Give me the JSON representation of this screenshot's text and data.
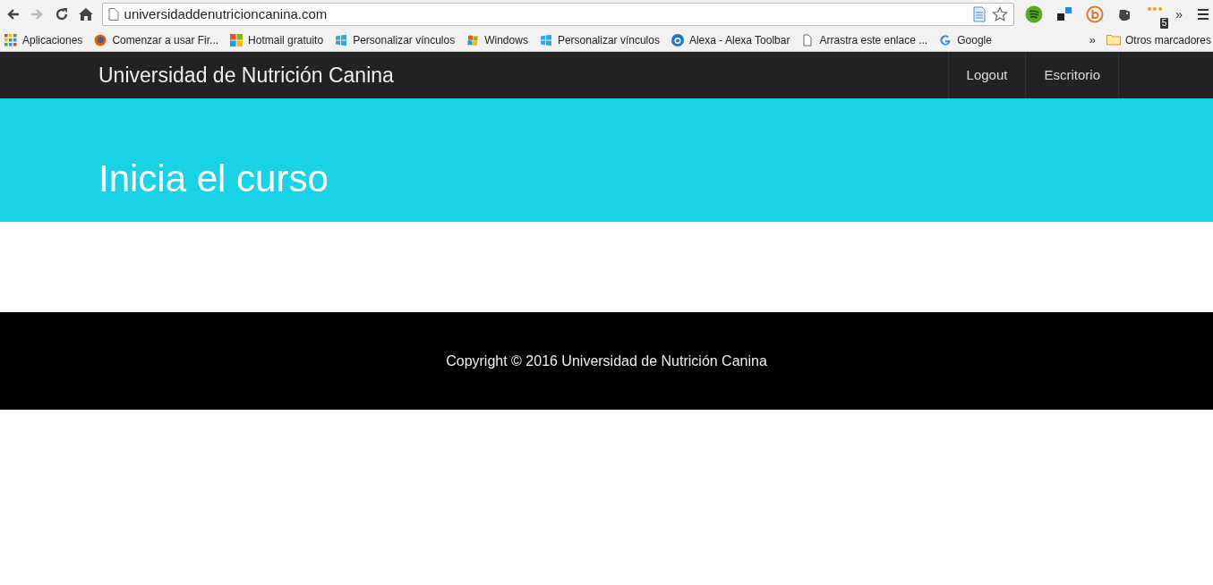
{
  "browser": {
    "url": "universidaddenutricioncanina.com",
    "extension_badge": "5",
    "extensions_overflow": "»",
    "bookmarks": [
      {
        "kind": "apps",
        "label": "Aplicaciones"
      },
      {
        "kind": "firefox",
        "label": "Comenzar a usar Fir..."
      },
      {
        "kind": "tiles",
        "label": "Hotmail gratuito"
      },
      {
        "kind": "windows",
        "label": "Personalizar vínculos"
      },
      {
        "kind": "flag",
        "label": "Windows"
      },
      {
        "kind": "windows",
        "label": "Personalizar vínculos"
      },
      {
        "kind": "alexa",
        "label": "Alexa - Alexa Toolbar"
      },
      {
        "kind": "page",
        "label": "Arrastra este enlace ..."
      },
      {
        "kind": "google",
        "label": "Google"
      }
    ],
    "bookmarks_overflow": "»",
    "other_bookmarks": "Otros marcadores"
  },
  "navbar": {
    "brand": "Universidad de Nutrición Canina",
    "links": [
      "Logout",
      "Escritorio"
    ]
  },
  "hero": {
    "title": "Inicia el curso"
  },
  "footer": {
    "copyright": "Copyright © 2016 Universidad de Nutrición Canina"
  }
}
